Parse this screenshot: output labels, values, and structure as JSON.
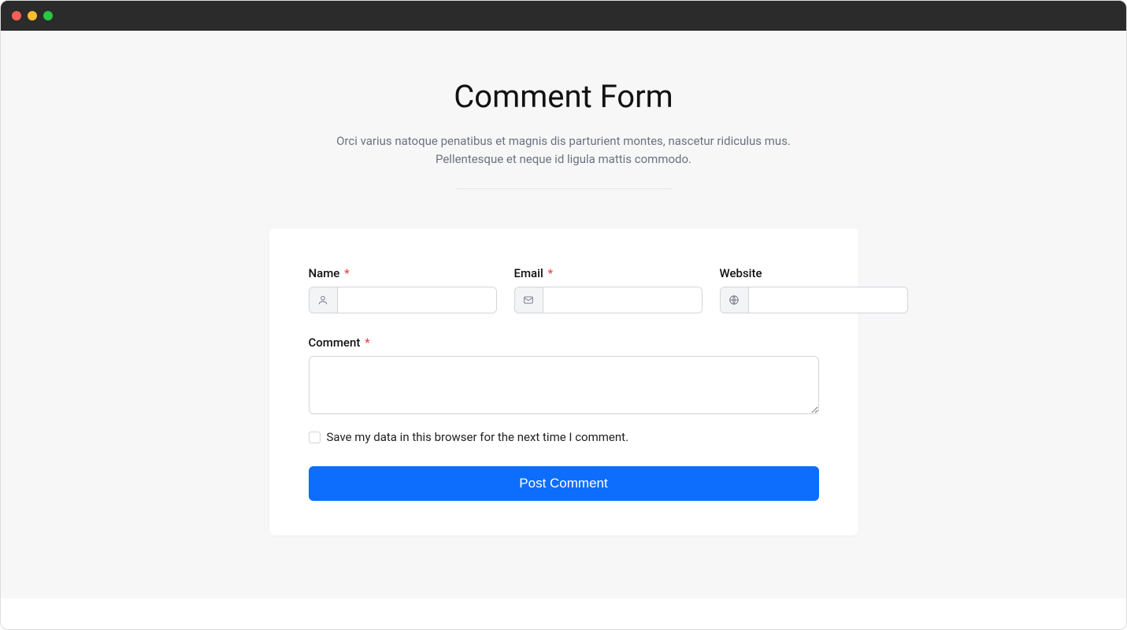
{
  "header": {
    "title": "Comment Form",
    "subtitle": "Orci varius natoque penatibus et magnis dis parturient montes, nascetur ridiculus mus. Pellentesque et neque id ligula mattis commodo."
  },
  "form": {
    "name": {
      "label": "Name",
      "required": true,
      "value": "",
      "icon": "user-icon"
    },
    "email": {
      "label": "Email",
      "required": true,
      "value": "",
      "icon": "mail-icon"
    },
    "website": {
      "label": "Website",
      "required": false,
      "value": "",
      "icon": "globe-icon"
    },
    "comment": {
      "label": "Comment",
      "required": true,
      "value": ""
    },
    "save_data_checkbox": {
      "label": "Save my data in this browser for the next time I comment.",
      "checked": false
    },
    "submit_label": "Post Comment",
    "required_marker": "*"
  },
  "colors": {
    "primary": "#0d6efd",
    "required": "#ef4444",
    "page_bg": "#f7f7f8",
    "card_bg": "#ffffff",
    "border": "#d1d5db",
    "muted_text": "#6b7280"
  }
}
